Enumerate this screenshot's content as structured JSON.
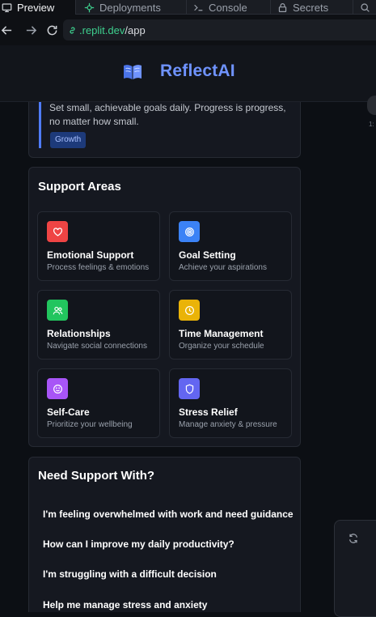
{
  "browser": {
    "tabs": [
      {
        "label": "Preview",
        "icon": "monitor-icon",
        "active": true
      },
      {
        "label": "Deployments",
        "icon": "deploy-icon",
        "active": false
      },
      {
        "label": "Console",
        "icon": "terminal-icon",
        "active": false
      },
      {
        "label": "Secrets",
        "icon": "lock-icon",
        "active": false
      }
    ],
    "url_domain": ".replit.dev",
    "url_path": "/app"
  },
  "app": {
    "brand": "ReflectAI",
    "brand_color": "#6f93ff"
  },
  "tip": {
    "text": "Set small, achievable goals daily. Progress is progress, no matter how small.",
    "badge": "Growth"
  },
  "support_areas": {
    "title": "Support Areas",
    "items": [
      {
        "title": "Emotional Support",
        "desc": "Process feelings & emotions",
        "icon": "heart-icon",
        "color": "#ef4444"
      },
      {
        "title": "Goal Setting",
        "desc": "Achieve your aspirations",
        "icon": "target-icon",
        "color": "#3b82f6"
      },
      {
        "title": "Relationships",
        "desc": "Navigate social connections",
        "icon": "users-icon",
        "color": "#22c55e"
      },
      {
        "title": "Time Management",
        "desc": "Organize your schedule",
        "icon": "clock-icon",
        "color": "#eab308"
      },
      {
        "title": "Self-Care",
        "desc": "Prioritize your wellbeing",
        "icon": "smile-icon",
        "color": "#a855f7"
      },
      {
        "title": "Stress Relief",
        "desc": "Manage anxiety & pressure",
        "icon": "shield-icon",
        "color": "#6366f1"
      }
    ]
  },
  "need_support": {
    "title": "Need Support With?",
    "prompts": [
      "I'm feeling overwhelmed with work and need guidance",
      "How can I improve my daily productivity?",
      "I'm struggling with a difficult decision",
      "Help me manage stress and anxiety"
    ]
  },
  "side": {
    "time_fragment": "1:"
  }
}
